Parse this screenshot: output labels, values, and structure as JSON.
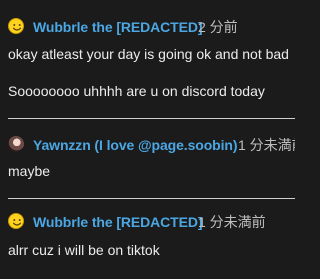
{
  "comments": [
    {
      "author": "Wubbrle the [REDACTED]",
      "avatar_icon": "yellow-smiley-icon",
      "time": "2 分前",
      "lines": [
        "okay atleast your day is going ok and not bad",
        "Soooooooo uhhhh are u on discord today"
      ]
    },
    {
      "author": "Yawnzzn (I love @page.soobin)",
      "avatar_icon": "profile-photo-avatar",
      "time": "1 分未満前",
      "lines": [
        "maybe"
      ]
    },
    {
      "author": "Wubbrle the [REDACTED]",
      "avatar_icon": "yellow-smiley-icon",
      "time": "1 分未満前",
      "lines": [
        "alrr cuz i will be on tiktok"
      ]
    }
  ],
  "colors": {
    "background": "#1b1b1b",
    "username": "#4ba7e3",
    "timestamp": "#bdbdbd",
    "text": "#ececec",
    "divider": "#cfcfcf"
  }
}
